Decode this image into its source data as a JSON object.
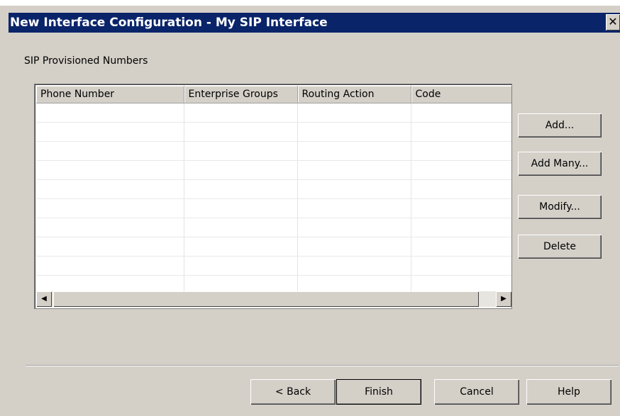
{
  "window": {
    "title": "New Interface Configuration - My SIP Interface",
    "close_glyph": "✕"
  },
  "section_label": "SIP Provisioned Numbers",
  "table": {
    "columns": [
      "Phone Number",
      "Enterprise Groups",
      "Routing Action",
      "Code"
    ],
    "rows": []
  },
  "side_buttons": {
    "add": "Add...",
    "add_many": "Add Many...",
    "modify": "Modify...",
    "delete": "Delete"
  },
  "footer_buttons": {
    "back": "< Back",
    "finish": "Finish",
    "cancel": "Cancel",
    "help": "Help"
  },
  "icons": {
    "scroll_left": "scroll-left-arrow-icon",
    "scroll_right": "scroll-right-arrow-icon",
    "close": "close-icon"
  },
  "colors": {
    "titlebar": "#0a246a",
    "dialog_face": "#d4d0c8"
  }
}
